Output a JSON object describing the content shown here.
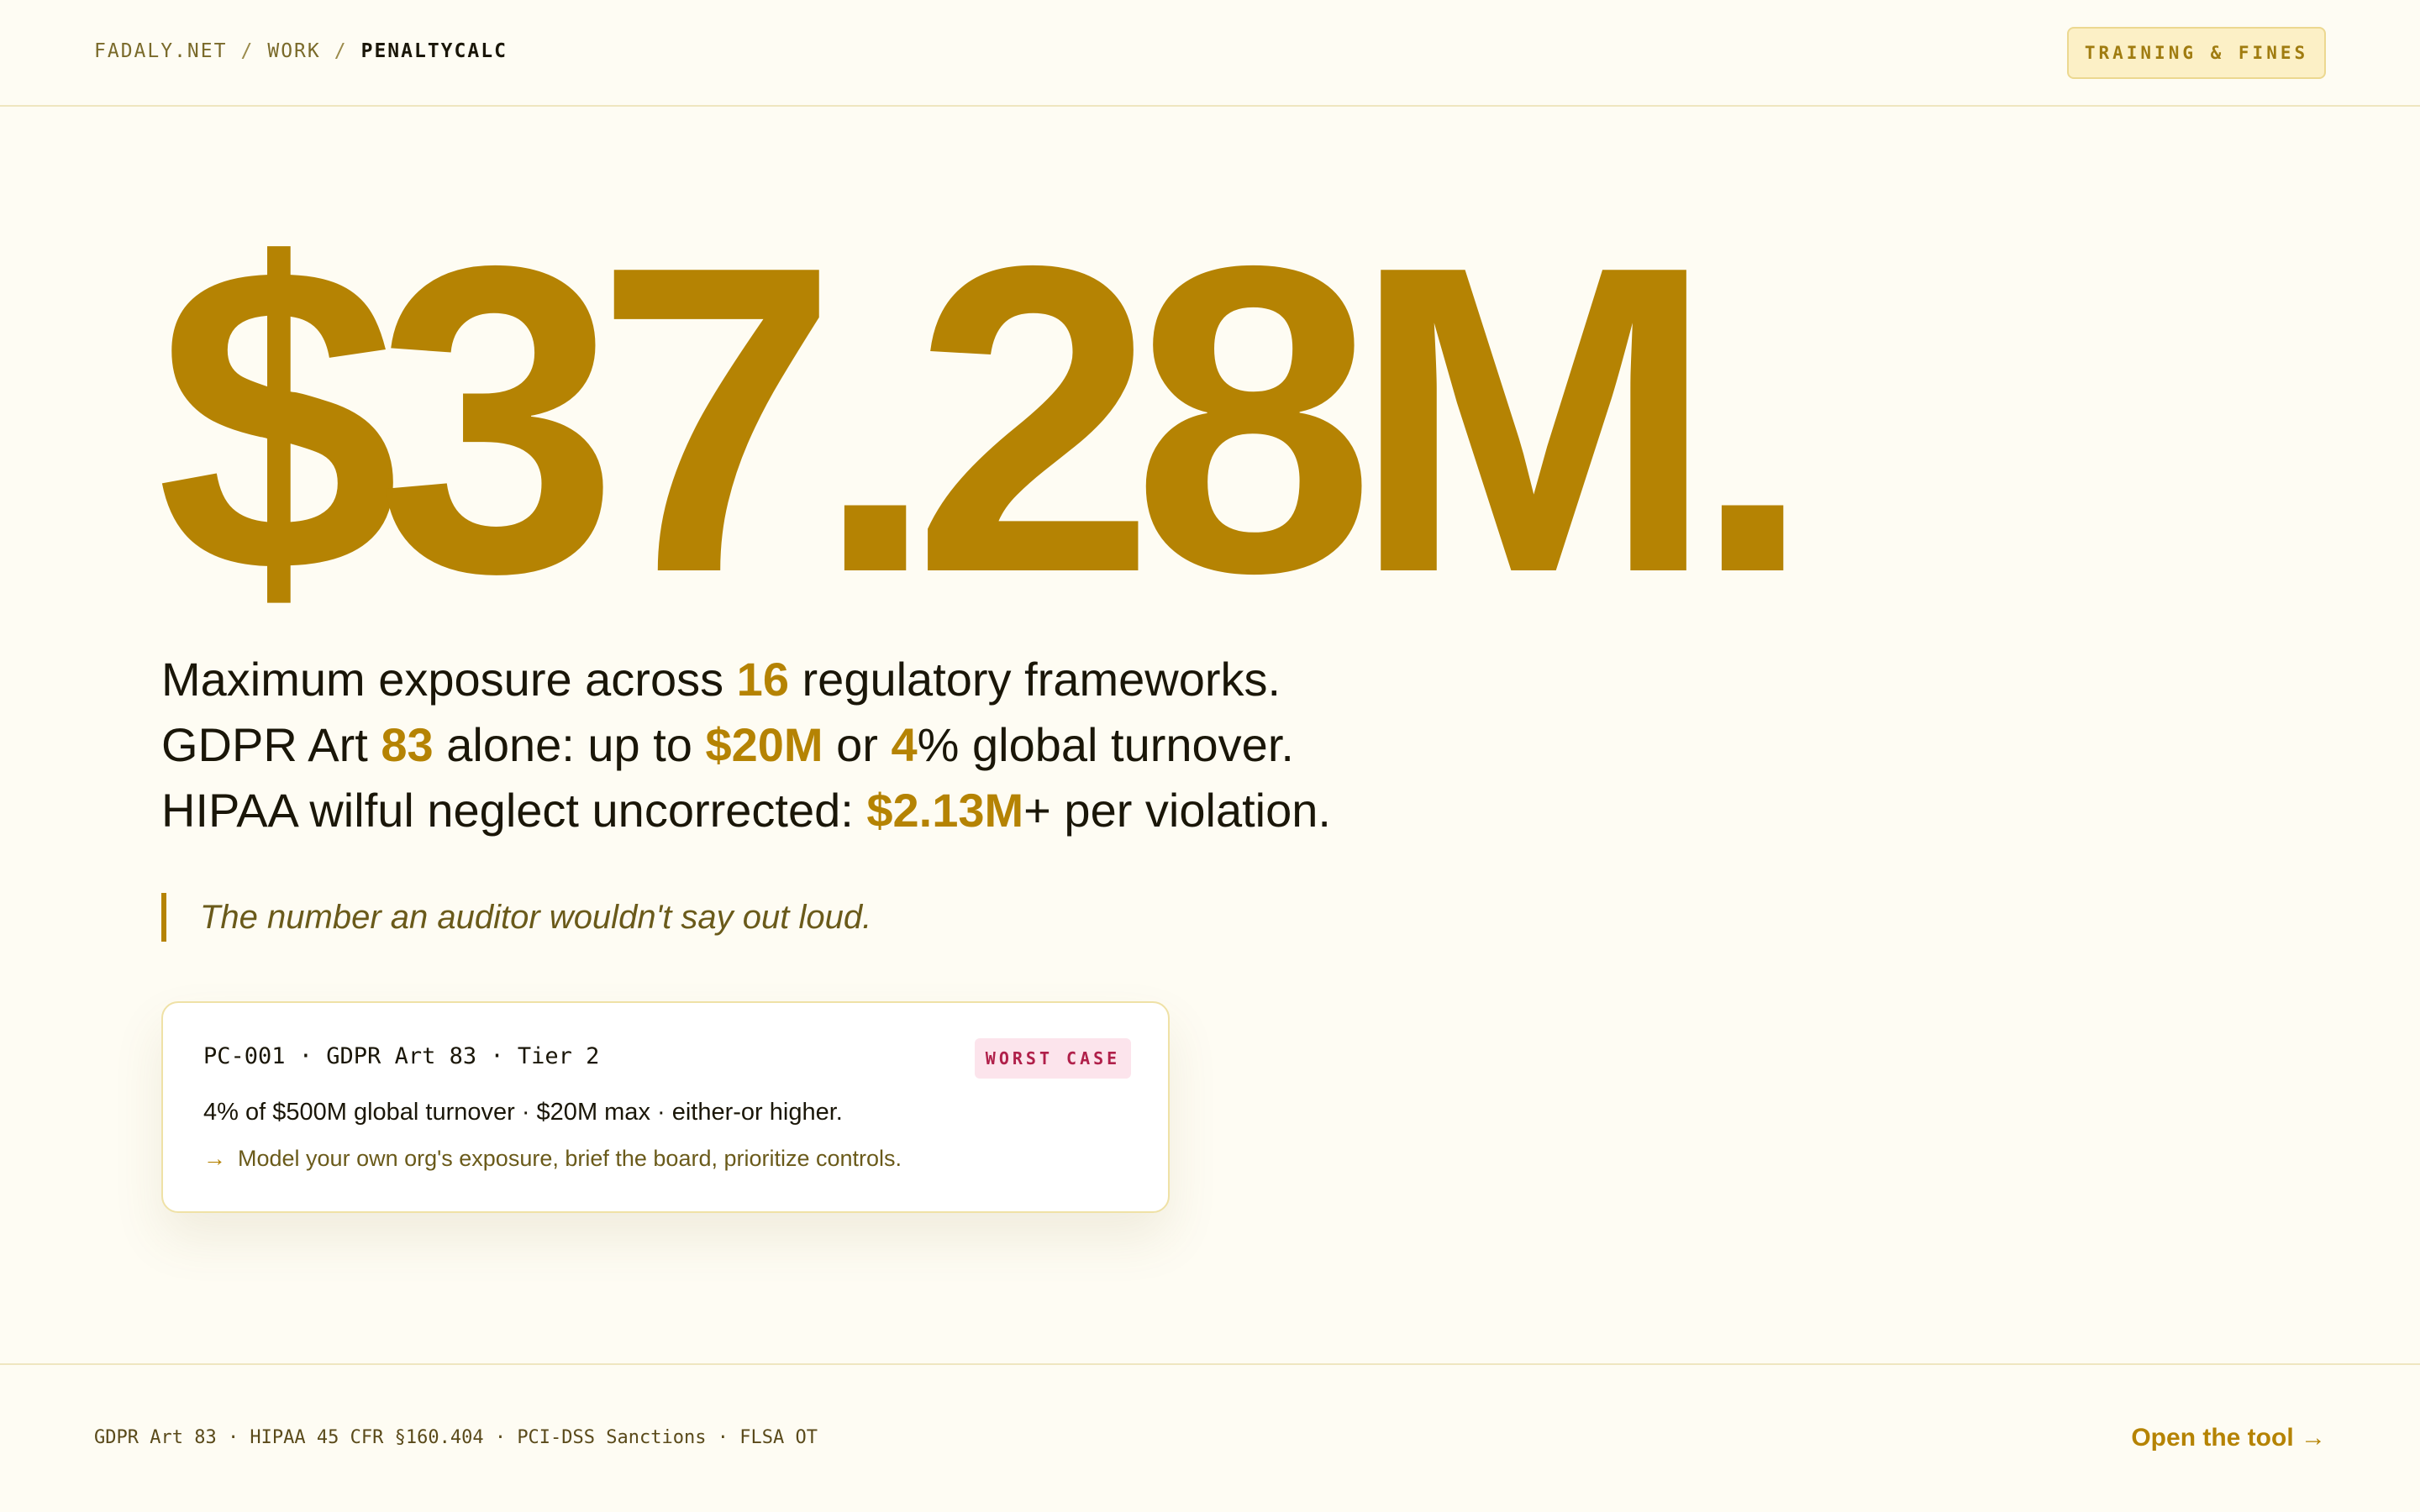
{
  "header": {
    "breadcrumbs": [
      "FADALY.NET",
      "WORK",
      "PENALTYCALC"
    ],
    "separator": "/",
    "tag": "TRAINING & FINES"
  },
  "hero": {
    "figure": "$37.28M."
  },
  "summary": {
    "line1": {
      "a": "Maximum exposure across ",
      "b": "16",
      "c": " regulatory frameworks."
    },
    "line2": {
      "a": "GDPR Art ",
      "b": "83",
      "c": " alone: up to ",
      "d": "$20M",
      "e": " or ",
      "f": "4",
      "g": "% global turnover."
    },
    "line3": {
      "a": "HIPAA wilful neglect uncorrected: ",
      "b": "$2.13M",
      "c": "+ per violation."
    }
  },
  "quote": "The number an auditor wouldn't say out loud.",
  "card": {
    "code": "PC-001 · GDPR Art 83 · Tier 2",
    "badge": "WORST CASE",
    "detail": "4% of $500M global turnover · $20M max · either-or higher.",
    "cta_arrow": "→",
    "cta": "Model your own org's exposure, brief the board, prioritize controls."
  },
  "footer": {
    "refs": "GDPR Art 83  ·  HIPAA 45 CFR §160.404  ·  PCI-DSS Sanctions  ·  FLSA OT",
    "open_tool": "Open the tool →"
  },
  "colors": {
    "accent": "#b58303",
    "background": "#fefcf3",
    "badge_bg": "#fce4ec",
    "badge_text": "#b0204a"
  }
}
